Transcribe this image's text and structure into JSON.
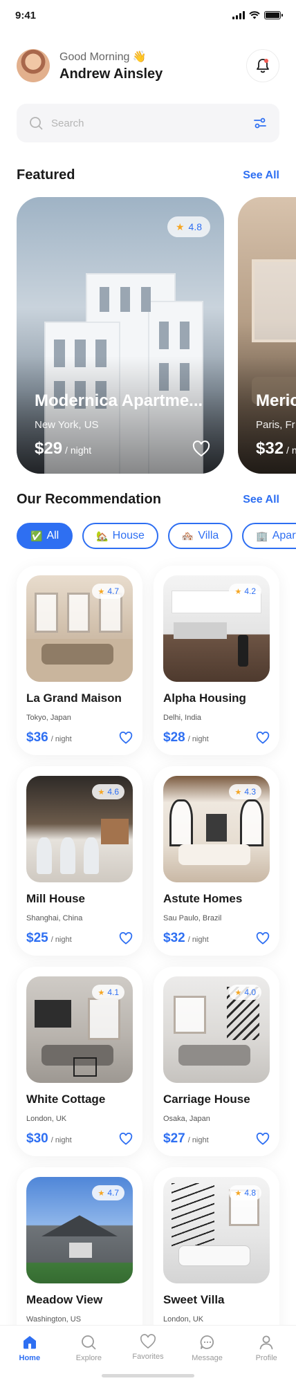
{
  "status": {
    "time": "9:41"
  },
  "header": {
    "greeting": "Good Morning 👋",
    "name": "Andrew Ainsley"
  },
  "search": {
    "placeholder": "Search"
  },
  "featured": {
    "title": "Featured",
    "see_all": "See All",
    "items": [
      {
        "rating": "4.8",
        "title": "Modernica Apartme...",
        "location": "New York, US",
        "price": "$29",
        "unit": "/ night"
      },
      {
        "title": "Meric",
        "location": "Paris, Fr",
        "price": "$32",
        "unit": "/ n"
      }
    ]
  },
  "recommendation": {
    "title": "Our Recommendation",
    "see_all": "See All",
    "filters": [
      {
        "emoji": "✅",
        "label": "All"
      },
      {
        "emoji": "🏡",
        "label": "House"
      },
      {
        "emoji": "🏘️",
        "label": "Villa"
      },
      {
        "emoji": "🏢",
        "label": "Apartm"
      }
    ],
    "items": [
      {
        "title": "La Grand Maison",
        "location": "Tokyo, Japan",
        "price": "$36",
        "unit": "/ night",
        "rating": "4.7"
      },
      {
        "title": "Alpha Housing",
        "location": "Delhi, India",
        "price": "$28",
        "unit": "/ night",
        "rating": "4.2"
      },
      {
        "title": "Mill House",
        "location": "Shanghai, China",
        "price": "$25",
        "unit": "/ night",
        "rating": "4.6"
      },
      {
        "title": "Astute Homes",
        "location": "Sau Paulo, Brazil",
        "price": "$32",
        "unit": "/ night",
        "rating": "4.3"
      },
      {
        "title": "White Cottage",
        "location": "London, UK",
        "price": "$30",
        "unit": "/ night",
        "rating": "4.1"
      },
      {
        "title": "Carriage House",
        "location": "Osaka, Japan",
        "price": "$27",
        "unit": "/ night",
        "rating": "4.0"
      },
      {
        "title": "Meadow View",
        "location": "Washington, US",
        "price": "",
        "unit": "",
        "rating": "4.7"
      },
      {
        "title": "Sweet Villa",
        "location": "London, UK",
        "price": "",
        "unit": "",
        "rating": "4.8"
      }
    ]
  },
  "tabbar": {
    "tabs": [
      {
        "label": "Home",
        "icon": "home-icon"
      },
      {
        "label": "Explore",
        "icon": "explore-icon"
      },
      {
        "label": "Favorites",
        "icon": "heart-icon"
      },
      {
        "label": "Message",
        "icon": "message-icon"
      },
      {
        "label": "Profile",
        "icon": "profile-icon"
      }
    ]
  },
  "colors": {
    "accent": "#2e6ff2",
    "star": "#f5a623"
  }
}
